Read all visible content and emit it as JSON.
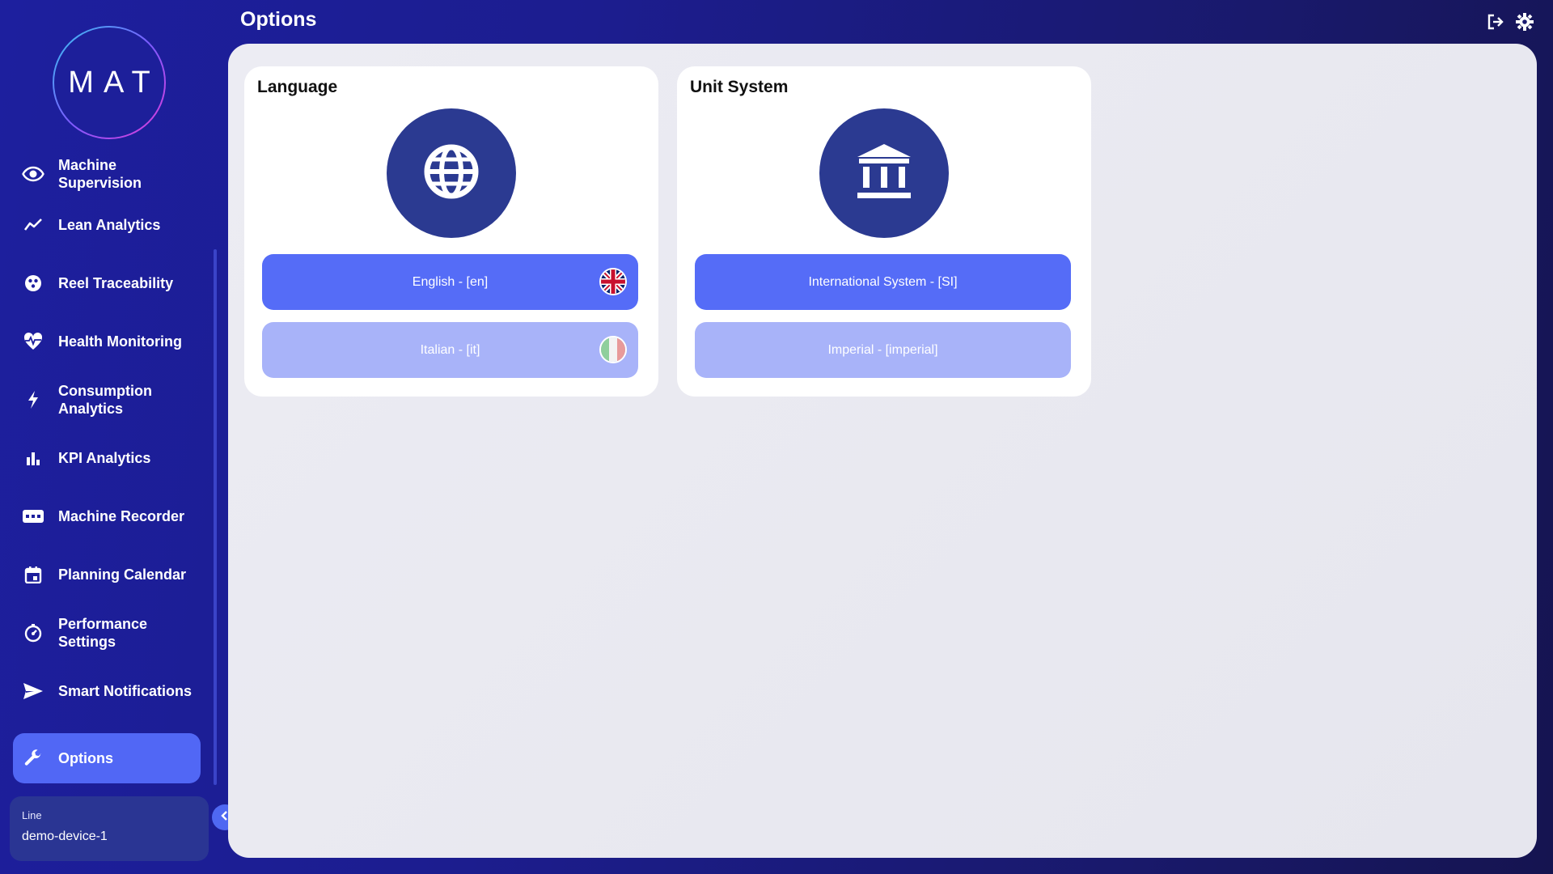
{
  "app": {
    "logo_text": "MAT",
    "page_title": "Options"
  },
  "sidebar": {
    "items": [
      {
        "label": "Machine Supervision",
        "icon": "eye-icon"
      },
      {
        "label": "Lean Analytics",
        "icon": "trend-line-icon"
      },
      {
        "label": "Reel Traceability",
        "icon": "reel-icon"
      },
      {
        "label": "Health Monitoring",
        "icon": "heart-pulse-icon"
      },
      {
        "label": "Consumption Analytics",
        "icon": "lightning-icon"
      },
      {
        "label": "KPI Analytics",
        "icon": "bar-chart-icon"
      },
      {
        "label": "Machine Recorder",
        "icon": "recorder-icon"
      },
      {
        "label": "Planning Calendar",
        "icon": "calendar-icon"
      },
      {
        "label": "Performance Settings",
        "icon": "gauge-icon"
      },
      {
        "label": "Smart Notifications",
        "icon": "send-icon"
      },
      {
        "label": "Options",
        "icon": "wrench-icon",
        "active": true
      }
    ],
    "line": {
      "label": "Line",
      "value": "demo-device-1"
    }
  },
  "header": {
    "icons": [
      "logout-icon",
      "settings-gear-icon"
    ]
  },
  "cards": {
    "language": {
      "title": "Language",
      "icon": "globe-icon",
      "options": [
        {
          "label": "English - [en]",
          "selected": true,
          "flag": "uk-flag-icon"
        },
        {
          "label": "Italian - [it]",
          "selected": false,
          "flag": "italy-flag-icon"
        }
      ]
    },
    "unit_system": {
      "title": "Unit System",
      "icon": "institution-icon",
      "options": [
        {
          "label": "International System - [SI]",
          "selected": true
        },
        {
          "label": "Imperial - [imperial]",
          "selected": false
        }
      ]
    }
  },
  "colors": {
    "accent": "#556cf7",
    "accent_light": "#a8b3f9",
    "icon_circle": "#2b3a91",
    "sidebar_bg": "#1d1f9e"
  }
}
